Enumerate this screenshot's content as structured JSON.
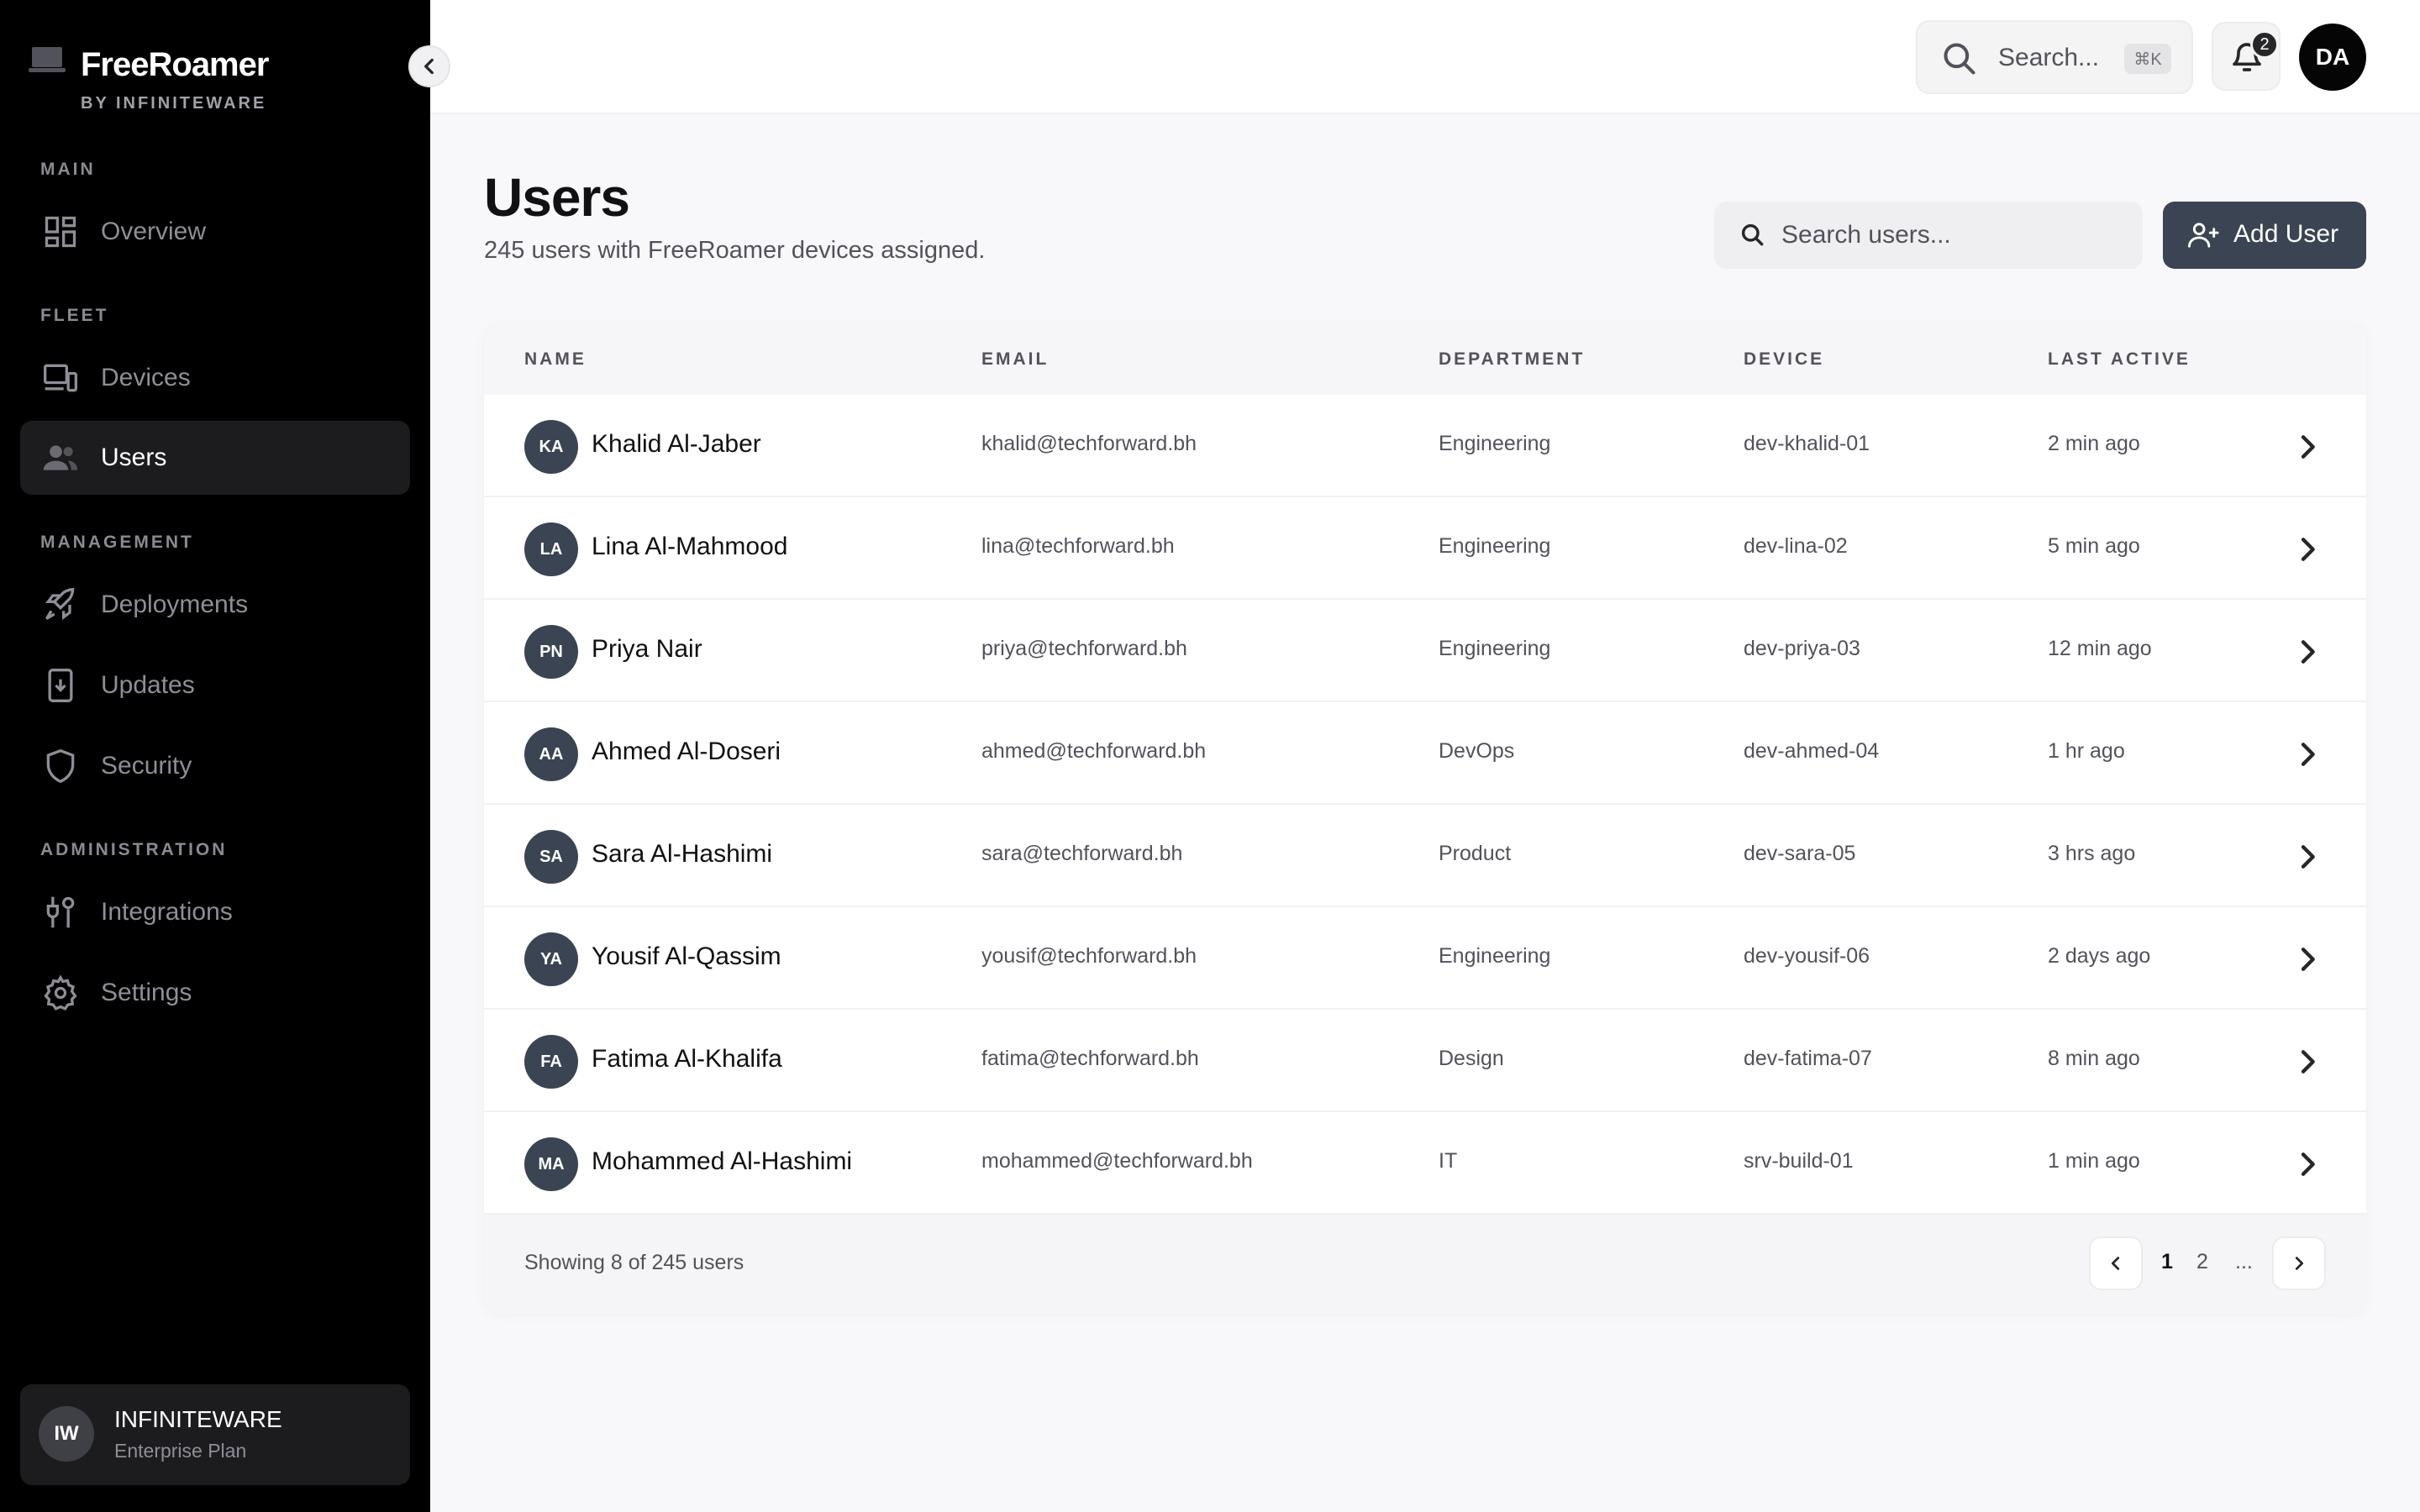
{
  "sidebar": {
    "brand_name": "FreeRoamer",
    "brand_sub": "BY INFINITEWARE",
    "sections": {
      "main": "MAIN",
      "fleet": "FLEET",
      "management": "MANAGEMENT",
      "administration": "ADMINISTRATION"
    },
    "items": [
      {
        "label": "Overview",
        "icon": "grid-icon"
      },
      {
        "label": "Devices",
        "icon": "devices-icon"
      },
      {
        "label": "Users",
        "icon": "users-icon",
        "active": true
      },
      {
        "label": "Deployments",
        "icon": "rocket-icon"
      },
      {
        "label": "Updates",
        "icon": "update-icon"
      },
      {
        "label": "Security",
        "icon": "shield-icon"
      },
      {
        "label": "Integrations",
        "icon": "plug-icon"
      },
      {
        "label": "Settings",
        "icon": "gear-icon"
      }
    ],
    "org": {
      "initials": "IW",
      "name": "INFINITEWARE",
      "plan": "Enterprise Plan"
    }
  },
  "topbar": {
    "search_placeholder": "Search...",
    "shortcut": "⌘K",
    "notifications_count": "2",
    "user_initials": "DA"
  },
  "main": {
    "title": "Users",
    "subtitle": "245 users with FreeRoamer devices assigned.",
    "search_placeholder": "Search users...",
    "add_button": "Add User"
  },
  "table": {
    "columns": [
      "NAME",
      "EMAIL",
      "DEPARTMENT",
      "DEVICE",
      "LAST ACTIVE"
    ],
    "rows": [
      {
        "initials": "KA",
        "name": "Khalid Al-Jaber",
        "email": "khalid@techforward.bh",
        "department": "Engineering",
        "device": "dev-khalid-01",
        "last_active": "2 min ago"
      },
      {
        "initials": "LA",
        "name": "Lina Al-Mahmood",
        "email": "lina@techforward.bh",
        "department": "Engineering",
        "device": "dev-lina-02",
        "last_active": "5 min ago"
      },
      {
        "initials": "PN",
        "name": "Priya Nair",
        "email": "priya@techforward.bh",
        "department": "Engineering",
        "device": "dev-priya-03",
        "last_active": "12 min ago"
      },
      {
        "initials": "AA",
        "name": "Ahmed Al-Doseri",
        "email": "ahmed@techforward.bh",
        "department": "DevOps",
        "device": "dev-ahmed-04",
        "last_active": "1 hr ago"
      },
      {
        "initials": "SA",
        "name": "Sara Al-Hashimi",
        "email": "sara@techforward.bh",
        "department": "Product",
        "device": "dev-sara-05",
        "last_active": "3 hrs ago"
      },
      {
        "initials": "YA",
        "name": "Yousif Al-Qassim",
        "email": "yousif@techforward.bh",
        "department": "Engineering",
        "device": "dev-yousif-06",
        "last_active": "2 days ago"
      },
      {
        "initials": "FA",
        "name": "Fatima Al-Khalifa",
        "email": "fatima@techforward.bh",
        "department": "Design",
        "device": "dev-fatima-07",
        "last_active": "8 min ago"
      },
      {
        "initials": "MA",
        "name": "Mohammed Al-Hashimi",
        "email": "mohammed@techforward.bh",
        "department": "IT",
        "device": "srv-build-01",
        "last_active": "1 min ago"
      }
    ],
    "footer": "Showing 8 of 245 users",
    "pages": [
      "1",
      "2",
      "..."
    ]
  },
  "colors": {
    "sidebar_bg": "#000000",
    "accent": "#3a4452",
    "page_bg": "#f8f8fa"
  }
}
